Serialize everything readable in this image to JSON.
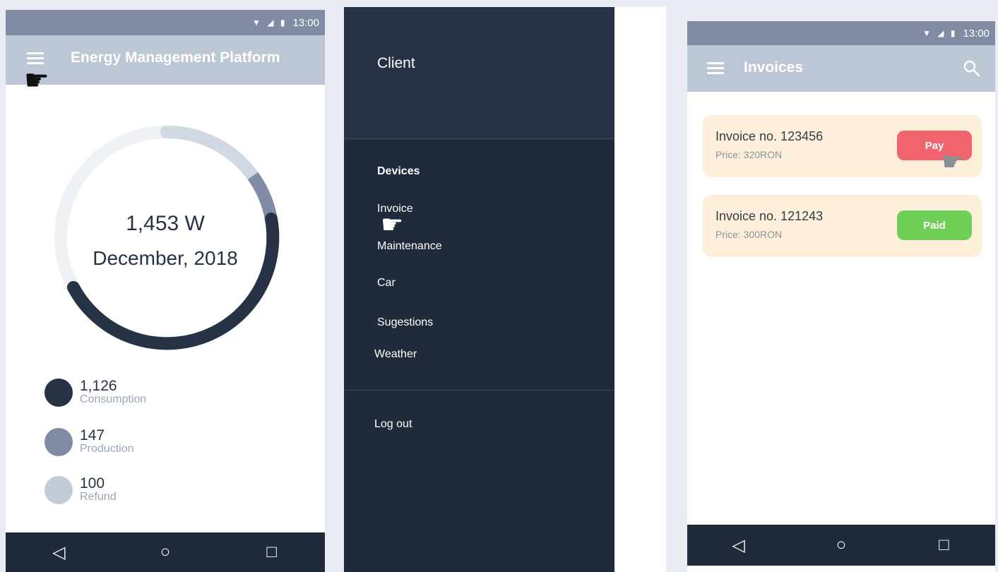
{
  "status": {
    "time": "13:00",
    "icons": "▼ ◢ ▮"
  },
  "nav": {
    "back": "◁",
    "home": "○",
    "recent": "□"
  },
  "dashboard": {
    "title": "Energy Management Platform",
    "power": "1,453 W",
    "period": "December, 2018",
    "legend": [
      {
        "value": "1,126",
        "label": "Consumption",
        "color": "#263345"
      },
      {
        "value": "147",
        "label": "Production",
        "color": "#7f8ca3"
      },
      {
        "value": "100",
        "label": "Refund",
        "color": "#c2ccd9"
      }
    ]
  },
  "drawer": {
    "header": "Client",
    "items": [
      "Devices",
      "Invoice",
      "Maintenance",
      "Car",
      "Sugestions",
      "Weather"
    ],
    "logout": "Log out"
  },
  "invoices": {
    "title": "Invoices",
    "list": [
      {
        "name": "Invoice no. 123456",
        "price": "Price: 320RON",
        "action": "Pay",
        "color": "#f1636d"
      },
      {
        "name": "Invoice no. 121243",
        "price": "Price: 300RON",
        "action": "Paid",
        "color": "#6fcf56"
      }
    ]
  },
  "colors": {
    "dark": "#1f2a3a",
    "appbar": "#bcc7d6",
    "statusbar": "#7f8ca3"
  }
}
